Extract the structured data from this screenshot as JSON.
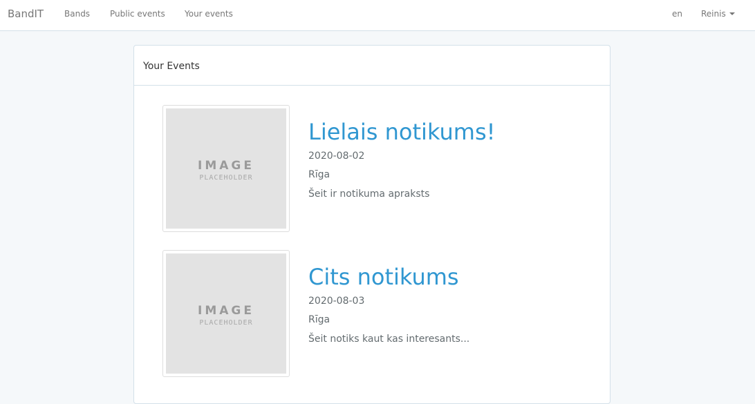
{
  "navbar": {
    "brand": "BandIT",
    "links": [
      "Bands",
      "Public events",
      "Your events"
    ],
    "language": "en",
    "user": "Reinis"
  },
  "panel": {
    "heading": "Your Events"
  },
  "events": [
    {
      "image": {
        "line1": "IMAGE",
        "line2": "PLACEHOLDER"
      },
      "title": "Lielais notikums!",
      "date": "2020-08-02",
      "location": "Rīga",
      "description": "Šeit ir notikuma apraksts"
    },
    {
      "image": {
        "line1": "IMAGE",
        "line2": "PLACEHOLDER"
      },
      "title": "Cits notikums",
      "date": "2020-08-03",
      "location": "Rīga",
      "description": "Šeit notiks kaut kas interesants..."
    }
  ],
  "colors": {
    "background": "#f5f8fa",
    "link": "#3097d1",
    "text": "#636b6f",
    "border": "#d3e0e9"
  }
}
